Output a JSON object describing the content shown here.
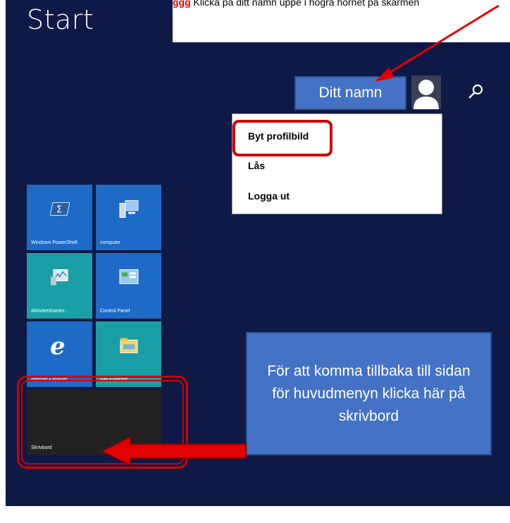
{
  "start_screen": {
    "title": "Start",
    "user_name": "Ditt namn",
    "top_annotation_left": "ggg",
    "top_annotation_right": "Klicka på ditt namn uppe i högra hörnet på skärmen"
  },
  "user_menu": {
    "items": [
      {
        "label": "Byt profilbild"
      },
      {
        "label": "Lås"
      },
      {
        "label": "Logga ut"
      }
    ]
  },
  "tiles": [
    {
      "label": "Windows PowerShell"
    },
    {
      "label": "computer"
    },
    {
      "label": "Aktivitetshanter..."
    },
    {
      "label": "Control Panel"
    },
    {
      "label": "Internet Explorer"
    },
    {
      "label": "File Explorer"
    },
    {
      "label": "Skrivbord"
    }
  ],
  "callout": {
    "text": "För att komma tillbaka till sidan för huvudmenyn klicka här på skrivbord"
  },
  "colors": {
    "background": "#0e1945",
    "tile_blue": "#1d6ac7",
    "tile_teal": "#1b9fa6",
    "annotation_blue": "#4472c4",
    "highlight_red": "#d00000"
  },
  "icons": [
    "user-avatar-icon",
    "search-icon",
    "powershell-icon",
    "computer-icon",
    "task-manager-icon",
    "control-panel-icon",
    "internet-explorer-icon",
    "file-explorer-icon"
  ]
}
